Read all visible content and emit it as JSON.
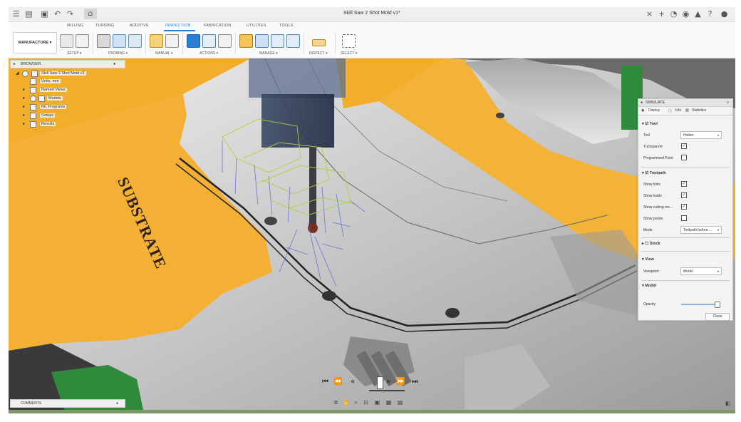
{
  "doc_title": "Skill Saw 2 Shot Mold v1*",
  "workspace": "MANUFACTURE ▾",
  "tabs": [
    "MILLING",
    "TURNING",
    "ADDITIVE",
    "INSPECTION",
    "FABRICATION",
    "UTILITIES",
    "TOOLS"
  ],
  "active_tab": "INSPECTION",
  "groups": [
    "SETUP ▾",
    "PROBING ▾",
    "MANUAL ▾",
    "ACTIONS ▾",
    "MANAGE ▾",
    "INSPECT ▾",
    "SELECT ▾"
  ],
  "browser": {
    "title": "BROWSER",
    "items": [
      "Skill Saw 2 Shot Mold v2",
      "Units: mm",
      "Named Views",
      "Models",
      "NC Programs",
      "Setups",
      "Results"
    ]
  },
  "model_text": "SUBSTRATE",
  "simulate": {
    "title": "SIMULATE",
    "tabs": [
      "Display",
      "Info",
      "Statistics"
    ],
    "tool_section": "Tool",
    "tool_label": "Tool",
    "tool_value": "Holder",
    "transparent_label": "Transparent",
    "programmed_point_label": "Programmed Point",
    "toolpath_section": "Toolpath",
    "show_links_label": "Show links",
    "show_leads_label": "Show leads",
    "show_cutting_label": "Show cutting mo...",
    "show_points_label": "Show points",
    "mode_label": "Mode",
    "mode_value": "Toolpath before ...",
    "stock_section": "Stock",
    "view_section": "View",
    "viewpoint_label": "Viewpoint",
    "viewpoint_value": "Model",
    "model_section": "Model",
    "opacity_label": "Opacity",
    "opacity_level": 0.95,
    "close_label": "Close"
  },
  "comments": "COMMENTS",
  "colors": {
    "accent": "#2a7fd4",
    "substrate": "#f2ae2b",
    "green": "#2f8a3c"
  }
}
